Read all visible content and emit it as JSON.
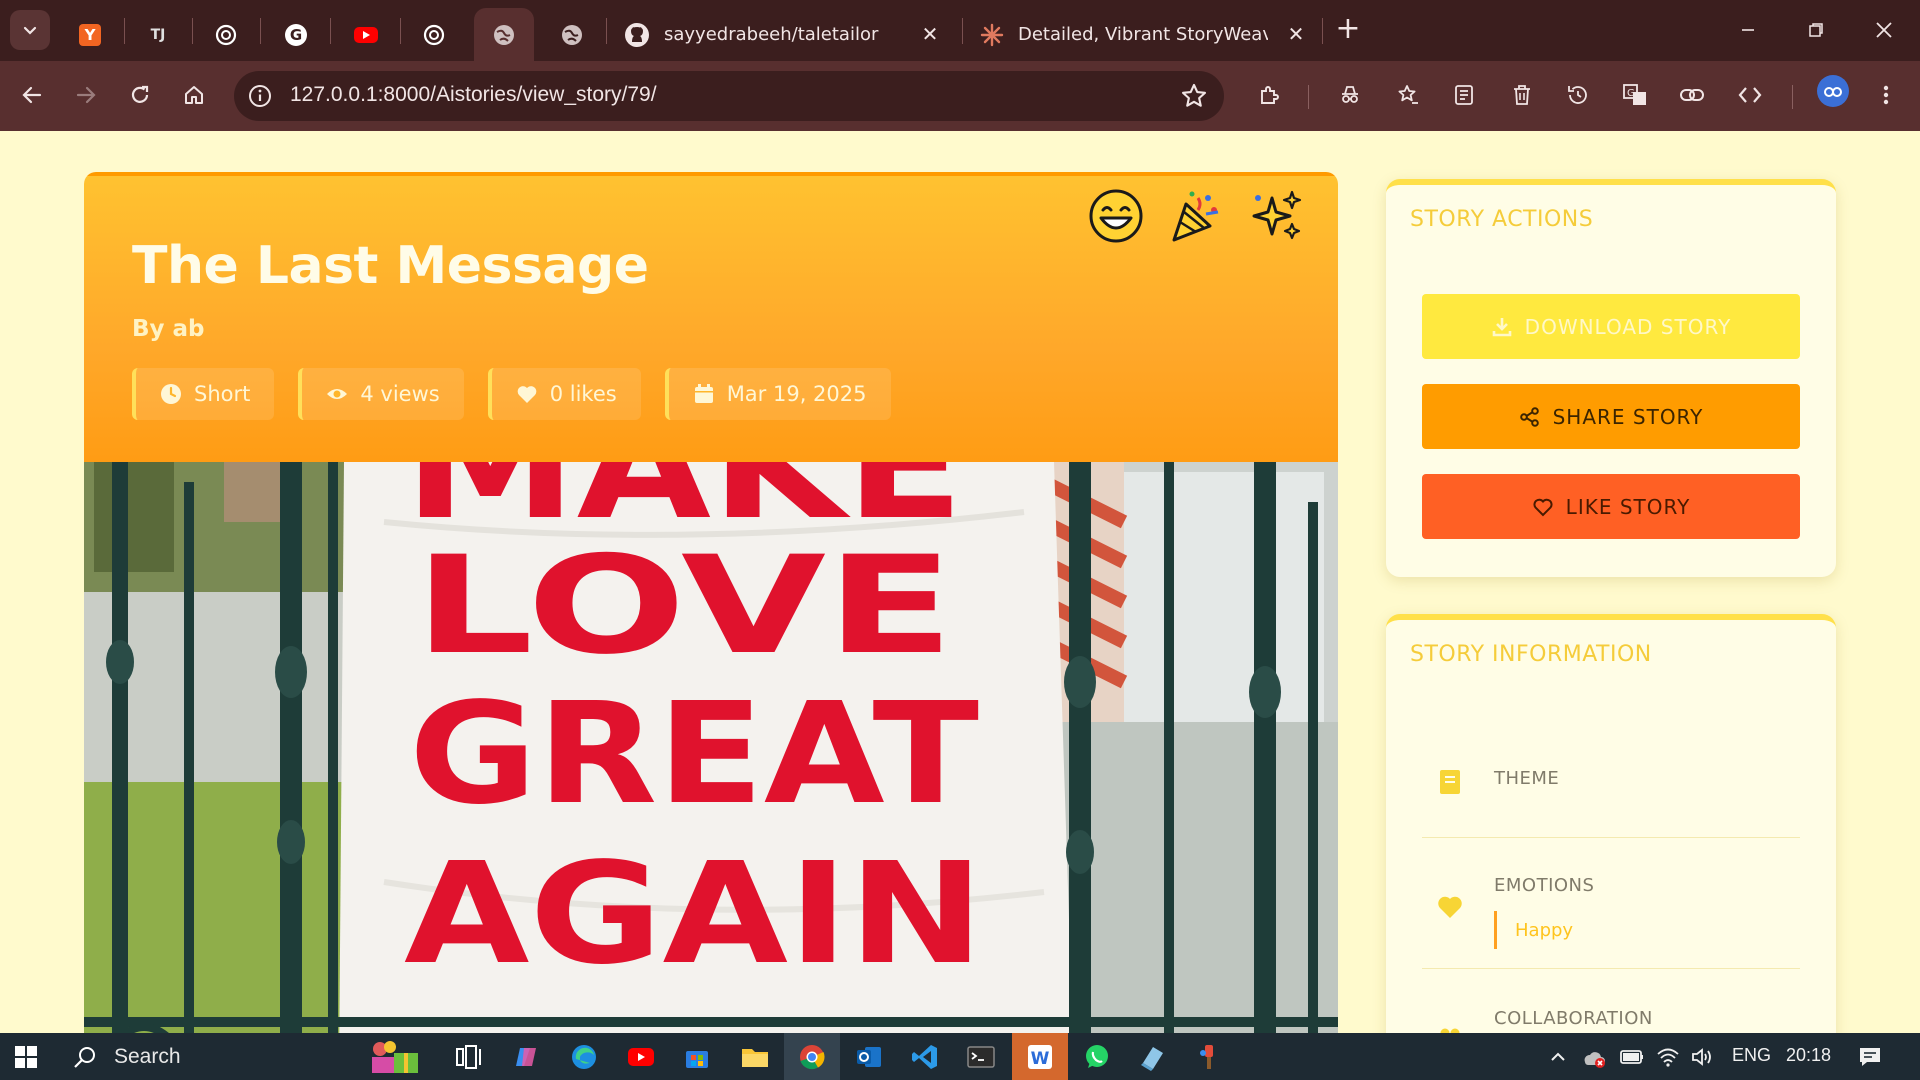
{
  "browser": {
    "tabs": [
      {
        "icon": "y-combinator-icon",
        "letter": "Y",
        "color": "#f26522"
      },
      {
        "icon": "tj-app-icon",
        "letter": "TJ",
        "color": "#e0e0e0"
      },
      {
        "icon": "openai-icon",
        "color": "#ffffff"
      },
      {
        "icon": "google-icon",
        "letter": "G",
        "color": "#ffffff"
      },
      {
        "icon": "youtube-icon",
        "color": "#ff0000"
      },
      {
        "icon": "openai-icon",
        "color": "#ffffff"
      },
      {
        "icon": "globe-icon",
        "color": "#cfc0c0",
        "active": true
      },
      {
        "icon": "globe-icon",
        "color": "#cfc0c0"
      },
      {
        "icon": "github-icon",
        "title": "sayyedrabeeh/taletailor"
      },
      {
        "icon": "claude-icon",
        "title": "Detailed, Vibrant StoryWeave R"
      }
    ],
    "url": "127.0.0.1:8000/Aistories/view_story/79/"
  },
  "story": {
    "title": "The Last Message",
    "author": "By ab",
    "meta": {
      "length": "Short",
      "views": "4 views",
      "likes": "0 likes",
      "date": "Mar 19, 2025"
    },
    "emojis": [
      "grinning-face-icon",
      "party-popper-icon",
      "sparkles-icon"
    ],
    "image_text": [
      "MAKE",
      "LOVE",
      "GREAT",
      "AGAIN"
    ]
  },
  "sidebar": {
    "actions_title": "STORY ACTIONS",
    "download_label": "DOWNLOAD STORY",
    "share_label": "SHARE STORY",
    "like_label": "LIKE STORY",
    "info_title": "STORY INFORMATION",
    "theme_label": "THEME",
    "emotions_label": "EMOTIONS",
    "emotion_value": "Happy",
    "collaboration_label": "COLLABORATION"
  },
  "taskbar": {
    "search_label": "Search",
    "language": "ENG",
    "time": "20:18"
  },
  "colors": {
    "page_bg": "#fffacd",
    "header_orange": "#ffa82a",
    "download_yellow": "#ffe93f",
    "share_orange": "#ff9c00",
    "like_red": "#ff6024",
    "browser_frame": "#582f2f"
  }
}
